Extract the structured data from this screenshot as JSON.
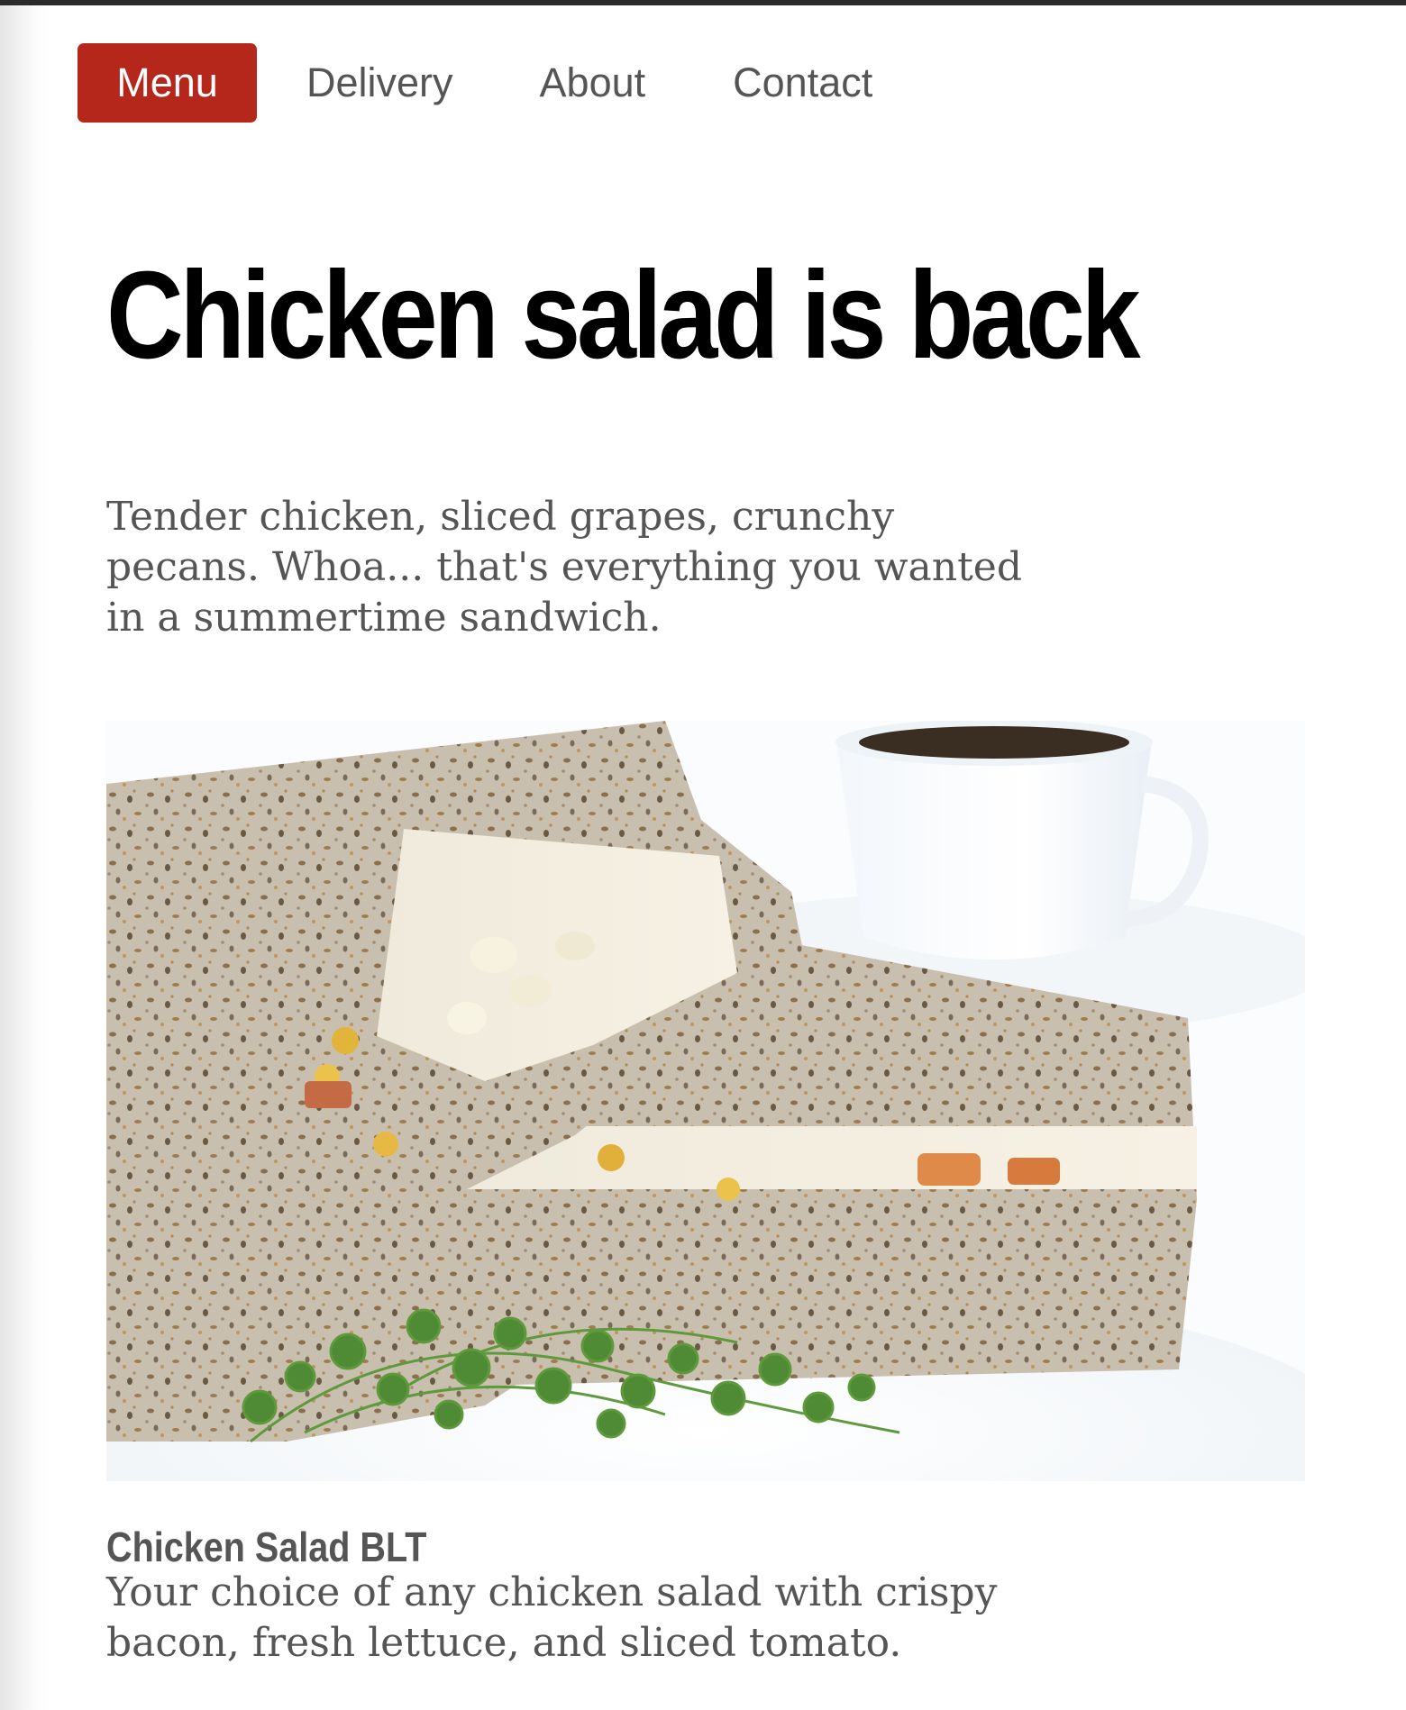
{
  "nav": {
    "items": [
      {
        "label": "Menu",
        "active": true
      },
      {
        "label": "Delivery",
        "active": false
      },
      {
        "label": "About",
        "active": false
      },
      {
        "label": "Contact",
        "active": false
      }
    ]
  },
  "hero": {
    "headline": "Chicken salad is back",
    "intro": "Tender chicken, sliced grapes, crunchy pecans. Whoa... that's everything you wanted in a summertime sandwich."
  },
  "menu_item": {
    "image_subject": "chicken salad sandwich with microgreens and coffee cup",
    "title": "Chicken Salad BLT",
    "description": "Your choice of any chicken salad with crispy bacon, fresh lettuce, and sliced tomato."
  },
  "colors": {
    "accent": "#b5261b",
    "nav_text": "#555555",
    "headline": "#000000",
    "body_text": "#555555",
    "background": "#ffffff"
  }
}
